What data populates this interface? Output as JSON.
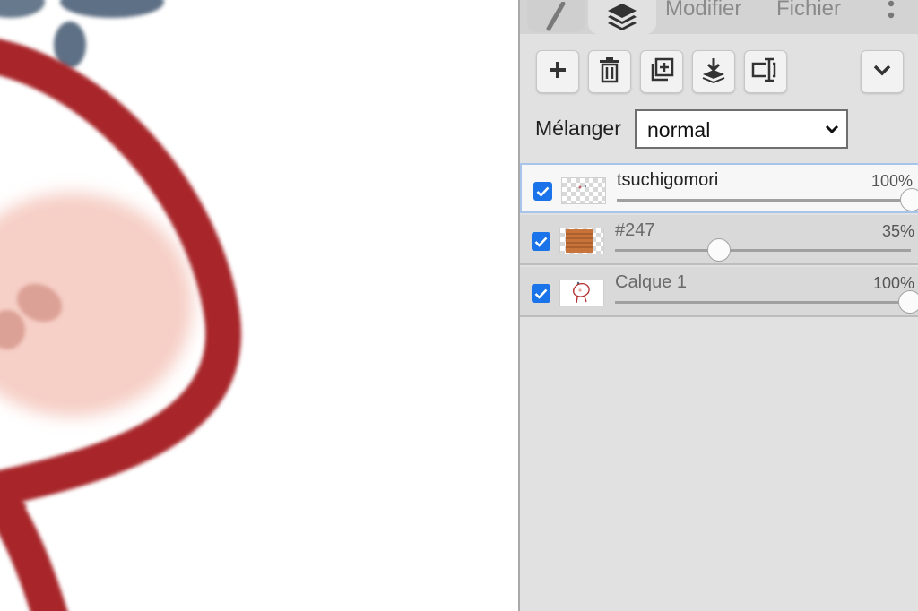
{
  "tabs": {
    "brush_icon": "brush-icon",
    "layers_icon": "layers-icon",
    "modifier": "Modifier",
    "fichier": "Fichier",
    "more_icon": "more-vertical-icon"
  },
  "toolbar": {
    "buttons": [
      "add-layer",
      "delete-layer",
      "duplicate-layer",
      "merge-down",
      "rename-layer"
    ],
    "collapse_icon": "chevron-down-icon"
  },
  "blend": {
    "label": "Mélanger",
    "value": "normal"
  },
  "layers": [
    {
      "name": "tsuchigomori",
      "opacity_label": "100%",
      "opacity": 1.0,
      "visible": true,
      "selected": true
    },
    {
      "name": "#247",
      "opacity_label": "35%",
      "opacity": 0.35,
      "visible": true,
      "selected": false
    },
    {
      "name": "Calque 1",
      "opacity_label": "100%",
      "opacity": 1.0,
      "visible": true,
      "selected": false
    }
  ],
  "colors": {
    "accent": "#1a73e8",
    "stroke_red": "#a8282a",
    "skin": "#f6cfc6",
    "ink_blue": "#4c6178",
    "panel_bg": "#e1e1e1"
  }
}
